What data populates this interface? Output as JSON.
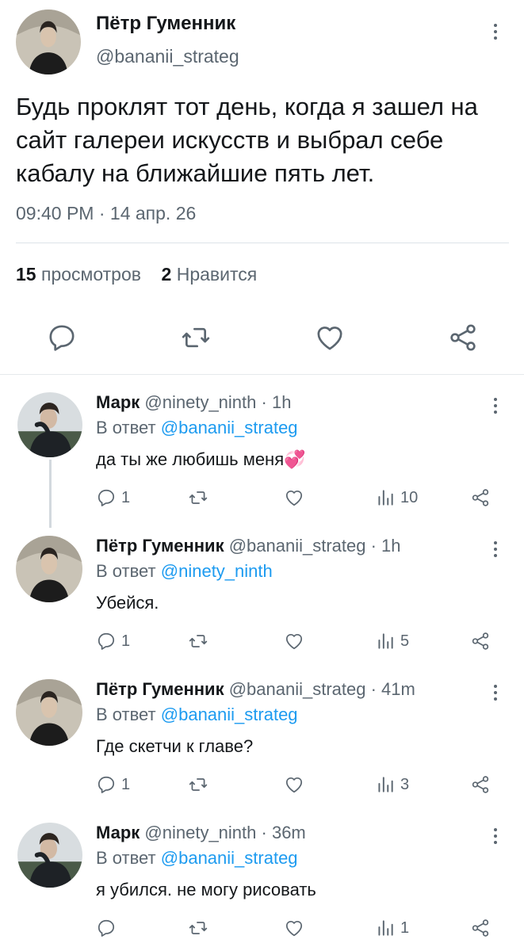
{
  "main_tweet": {
    "author_name": "Пётр Гуменник",
    "author_handle": "@bananii_strateg",
    "text": "Будь проклят тот день, когда я зашел на сайт галереи искусств и выбрал себе кабалу на ближайшие пять лет.",
    "time": "09:40 PM",
    "separator": "·",
    "date": "14 апр. 26",
    "views_count": "15",
    "views_label": "просмотров",
    "likes_count": "2",
    "likes_label": "Нравится"
  },
  "replies": [
    {
      "author_name": "Марк",
      "author_handle": "@ninety_ninth",
      "age": "· 1h",
      "reply_to_label": "В ответ",
      "reply_to_handle": "@bananii_strateg",
      "text": "да ты же любишь меня💞",
      "reply_count": "1",
      "view_count": "10"
    },
    {
      "author_name": "Пётр Гуменник",
      "author_handle": "@bananii_strateg",
      "age": "· 1h",
      "reply_to_label": "В ответ",
      "reply_to_handle": "@ninety_ninth",
      "text": "Убейся.",
      "reply_count": "1",
      "view_count": "5"
    },
    {
      "author_name": "Пётр Гуменник",
      "author_handle": "@bananii_strateg",
      "age": "· 41m",
      "reply_to_label": "В ответ",
      "reply_to_handle": "@bananii_strateg",
      "text": "Где скетчи к главе?",
      "reply_count": "1",
      "view_count": "3"
    },
    {
      "author_name": "Марк",
      "author_handle": "@ninety_ninth",
      "age": "· 36m",
      "reply_to_label": "В ответ",
      "reply_to_handle": "@bananii_strateg",
      "text": "я убился. не могу рисовать",
      "reply_count": "",
      "view_count": "1"
    }
  ],
  "icons": [
    "reply-icon",
    "retweet-icon",
    "like-icon",
    "share-icon",
    "views-icon",
    "more-icon"
  ],
  "colors": {
    "link": "#1d9bf0",
    "muted": "#5b6670",
    "text": "#14171a"
  }
}
